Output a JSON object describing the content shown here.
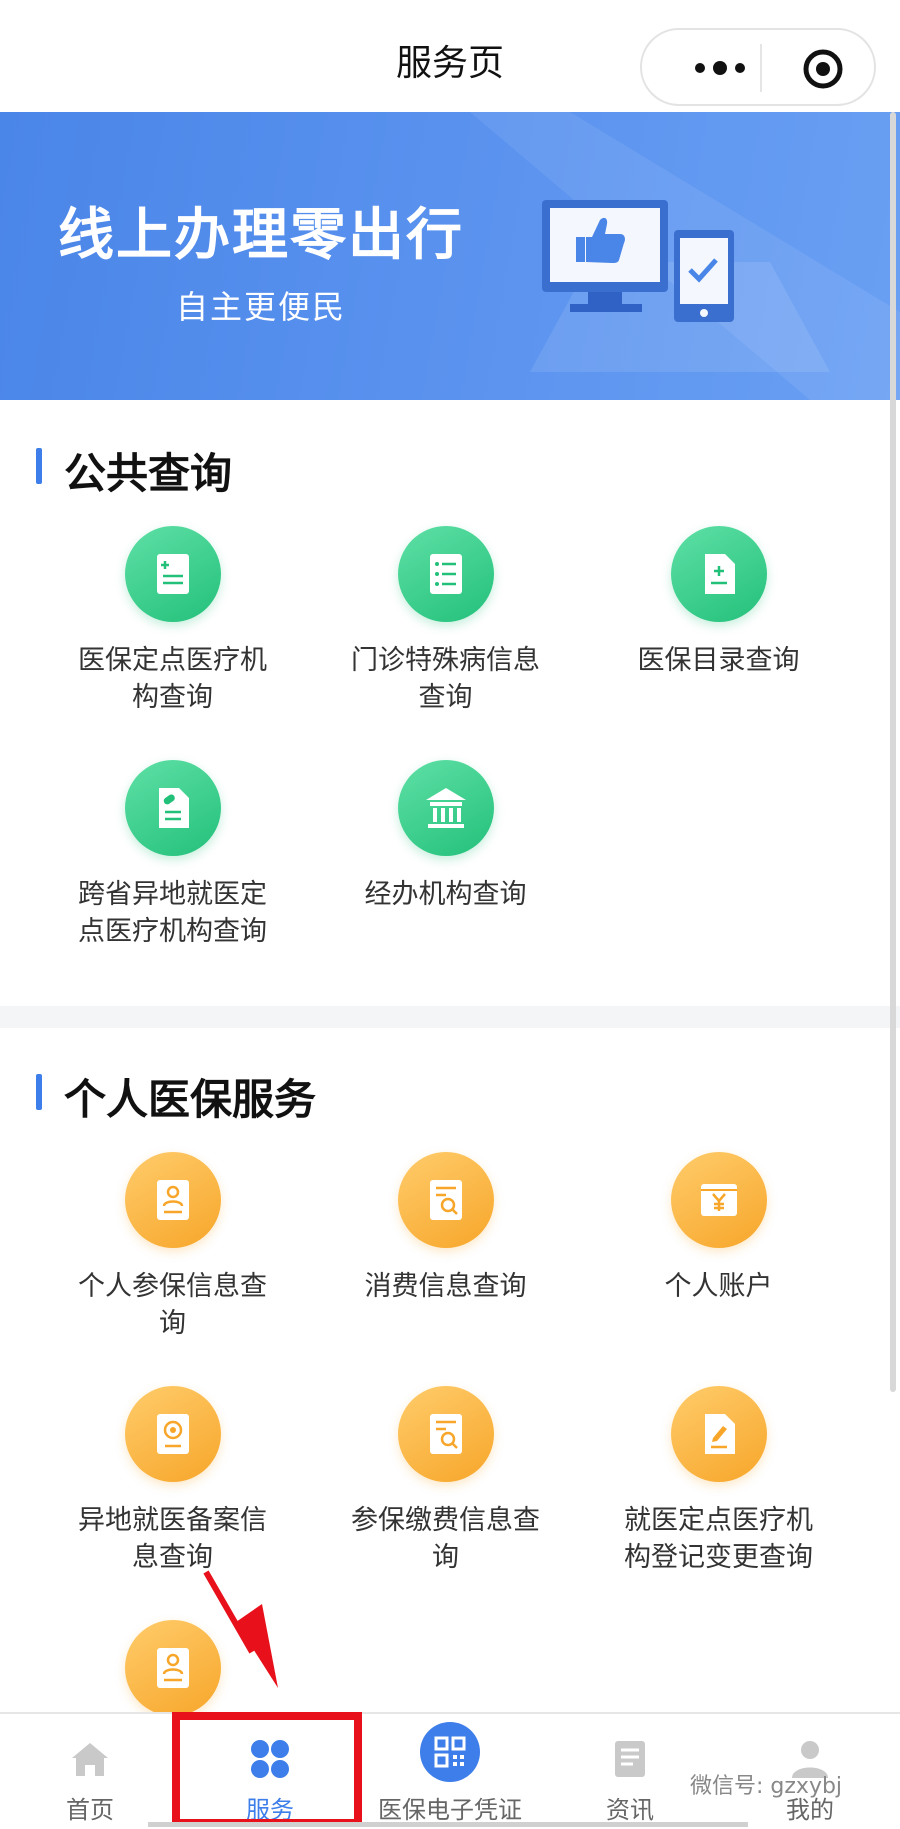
{
  "header": {
    "title": "服务页"
  },
  "banner": {
    "title": "线上办理零出行",
    "subtitle": "自主更便民"
  },
  "sections": [
    {
      "title": "公共查询",
      "color": "#23c07a",
      "items": [
        {
          "label": "医保定点医疗机构查询",
          "icon": "medical-doc-icon"
        },
        {
          "label": "门诊特殊病信息查询",
          "icon": "list-doc-icon"
        },
        {
          "label": "医保目录查询",
          "icon": "file-plus-icon"
        },
        {
          "label": "跨省异地就医定点医疗机构查询",
          "icon": "pill-doc-icon"
        },
        {
          "label": "经办机构查询",
          "icon": "institution-icon"
        }
      ]
    },
    {
      "title": "个人医保服务",
      "color": "#f7a62a",
      "items": [
        {
          "label": "个人参保信息查询",
          "icon": "person-card-icon"
        },
        {
          "label": "消费信息查询",
          "icon": "search-doc-icon"
        },
        {
          "label": "个人账户",
          "icon": "wallet-yen-icon"
        },
        {
          "label": "异地就医备案信息查询",
          "icon": "camera-doc-icon"
        },
        {
          "label": "参保缴费信息查询",
          "icon": "search-doc-icon"
        },
        {
          "label": "就医定点医疗机构登记变更查询",
          "icon": "edit-doc-icon"
        },
        {
          "label": "",
          "icon": "person-card-icon"
        }
      ]
    }
  ],
  "nav": {
    "items": [
      {
        "label": "首页",
        "icon": "home-icon"
      },
      {
        "label": "服务",
        "icon": "grid-icon",
        "active": true
      },
      {
        "label": "医保电子凭证",
        "icon": "qr-code-icon"
      },
      {
        "label": "资讯",
        "icon": "news-icon"
      },
      {
        "label": "我的",
        "icon": "user-icon"
      }
    ]
  },
  "watermark": "微信号: gzxybj",
  "colors": {
    "accent": "#3d7eea",
    "highlight": "#e8101a"
  }
}
